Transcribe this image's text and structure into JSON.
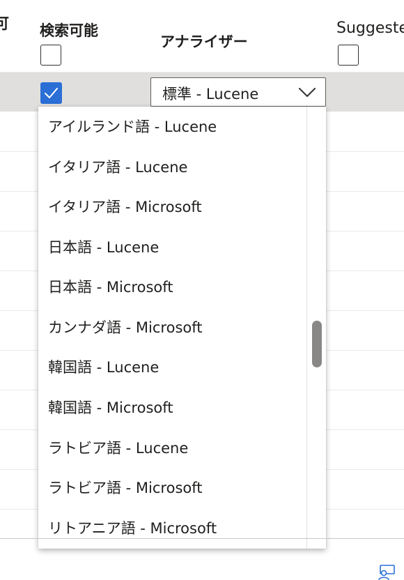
{
  "columns": {
    "prev_fragment": "可",
    "searchable": "検索可能",
    "analyzer": "アナライザー",
    "suggester": "Suggester"
  },
  "selected_row": {
    "searchable_checked": true,
    "analyzer_value": "標準 - Lucene"
  },
  "dropdown": {
    "options": [
      "アイルランド語 - Lucene",
      "イタリア語 - Lucene",
      "イタリア語 - Microsoft",
      "日本語 - Lucene",
      "日本語 - Microsoft",
      "カンナダ語 - Microsoft",
      "韓国語 - Lucene",
      "韓国語 - Microsoft",
      "ラトビア語 - Lucene",
      "ラトビア語 - Microsoft",
      "リトアニア語 - Microsoft"
    ]
  },
  "colors": {
    "accent": "#2b6fd6",
    "selected_row": "#e1dfdd",
    "scroll_thumb": "#8a8886"
  },
  "icons": {
    "chevron": "chevron-down-icon",
    "check": "checkmark-icon",
    "corner": "feedback-person-icon"
  }
}
